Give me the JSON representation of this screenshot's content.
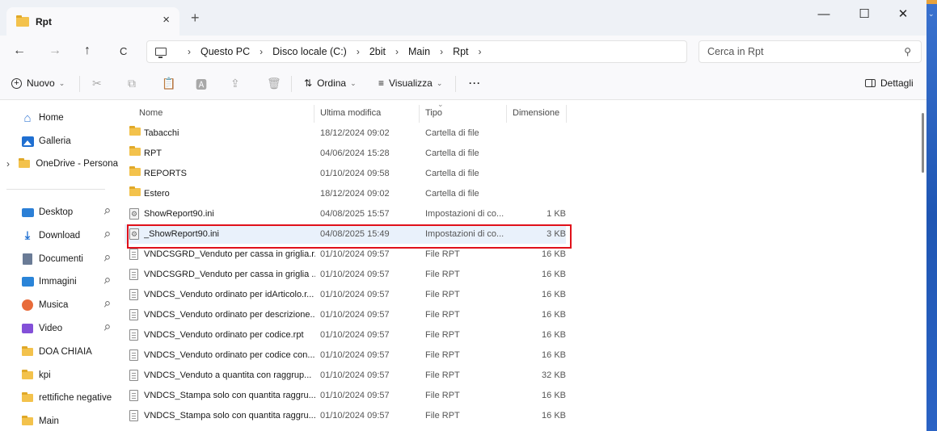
{
  "window": {
    "tab_label": "Rpt",
    "tab_close": "×",
    "new_tab": "+",
    "minimize": "—",
    "maximize": "☐",
    "close": "✕"
  },
  "address": {
    "back": "←",
    "forward": "→",
    "up": "↑",
    "refresh": "C",
    "separator": "›",
    "breadcrumbs": [
      "Questo PC",
      "Disco locale (C:)",
      "2bit",
      "Main",
      "Rpt"
    ],
    "search_placeholder": "Cerca in Rpt"
  },
  "commands": {
    "new_label": "Nuovo",
    "sort_label": "Ordina",
    "view_label": "Visualizza",
    "more_label": "···",
    "details_label": "Dettagli",
    "caret": "⌄"
  },
  "sidebar": {
    "expand_arrow": "›",
    "pin_glyph": "📌",
    "top_items": [
      "Home",
      "Galleria",
      "OneDrive - Persona"
    ],
    "quick_items": [
      {
        "label": "Desktop",
        "icon": "desktop-icon",
        "pinned": true
      },
      {
        "label": "Download",
        "icon": "download-icon",
        "pinned": true
      },
      {
        "label": "Documenti",
        "icon": "documents-icon",
        "pinned": true
      },
      {
        "label": "Immagini",
        "icon": "pictures-icon",
        "pinned": true
      },
      {
        "label": "Musica",
        "icon": "music-icon",
        "pinned": true
      },
      {
        "label": "Video",
        "icon": "video-icon",
        "pinned": true
      },
      {
        "label": "DOA CHIAIA",
        "icon": "folder-icon",
        "pinned": false
      },
      {
        "label": "kpi",
        "icon": "folder-icon",
        "pinned": false
      },
      {
        "label": "rettifiche negative",
        "icon": "folder-icon",
        "pinned": false
      },
      {
        "label": "Main",
        "icon": "folder-icon",
        "pinned": false
      }
    ]
  },
  "columns": {
    "name": "Nome",
    "modified": "Ultima modifica",
    "type": "Tipo",
    "size": "Dimensione",
    "sort_indicator": "⌄"
  },
  "files": [
    {
      "name": "Tabacchi",
      "modified": "18/12/2024 09:02",
      "type": "Cartella di file",
      "size": "",
      "kind": "folder"
    },
    {
      "name": "RPT",
      "modified": "04/06/2024 15:28",
      "type": "Cartella di file",
      "size": "",
      "kind": "folder"
    },
    {
      "name": "REPORTS",
      "modified": "01/10/2024 09:58",
      "type": "Cartella di file",
      "size": "",
      "kind": "folder"
    },
    {
      "name": "Estero",
      "modified": "18/12/2024 09:02",
      "type": "Cartella di file",
      "size": "",
      "kind": "folder"
    },
    {
      "name": "ShowReport90.ini",
      "modified": "04/08/2025 15:57",
      "type": "Impostazioni di co...",
      "size": "1 KB",
      "kind": "ini"
    },
    {
      "name": "_ShowReport90.ini",
      "modified": "04/08/2025 15:49",
      "type": "Impostazioni di co...",
      "size": "3 KB",
      "kind": "ini"
    },
    {
      "name": "VNDCSGRD_Venduto per cassa in griglia.r...",
      "modified": "01/10/2024 09:57",
      "type": "File RPT",
      "size": "16 KB",
      "kind": "file"
    },
    {
      "name": "VNDCSGRD_Venduto per cassa in griglia ...",
      "modified": "01/10/2024 09:57",
      "type": "File RPT",
      "size": "16 KB",
      "kind": "file"
    },
    {
      "name": "VNDCS_Venduto ordinato per idArticolo.r...",
      "modified": "01/10/2024 09:57",
      "type": "File RPT",
      "size": "16 KB",
      "kind": "file"
    },
    {
      "name": "VNDCS_Venduto ordinato per descrizione...",
      "modified": "01/10/2024 09:57",
      "type": "File RPT",
      "size": "16 KB",
      "kind": "file"
    },
    {
      "name": "VNDCS_Venduto ordinato per codice.rpt",
      "modified": "01/10/2024 09:57",
      "type": "File RPT",
      "size": "16 KB",
      "kind": "file"
    },
    {
      "name": "VNDCS_Venduto ordinato per codice con...",
      "modified": "01/10/2024 09:57",
      "type": "File RPT",
      "size": "16 KB",
      "kind": "file"
    },
    {
      "name": "VNDCS_Venduto a quantita con raggrup...",
      "modified": "01/10/2024 09:57",
      "type": "File RPT",
      "size": "32 KB",
      "kind": "file"
    },
    {
      "name": "VNDCS_Stampa solo con quantita raggru...",
      "modified": "01/10/2024 09:57",
      "type": "File RPT",
      "size": "16 KB",
      "kind": "file"
    },
    {
      "name": "VNDCS_Stampa solo con quantita raggru...",
      "modified": "01/10/2024 09:57",
      "type": "File RPT",
      "size": "16 KB",
      "kind": "file"
    }
  ],
  "highlighted_row": 5,
  "colors": {
    "highlight": "#e0101a",
    "accent": "#1f6fd1",
    "folder": "#f3c24c"
  }
}
